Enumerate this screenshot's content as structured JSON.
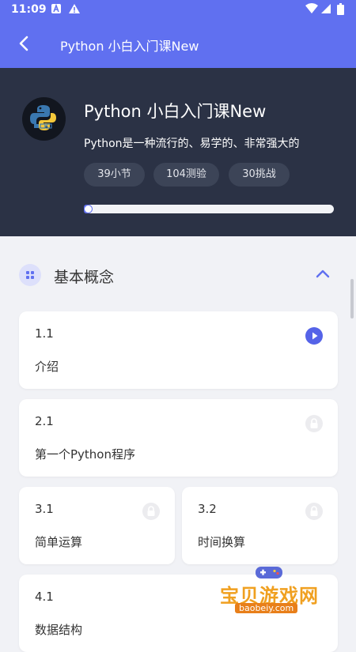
{
  "status_bar": {
    "time": "11:09"
  },
  "app_bar": {
    "title": "Python 小白入门课New"
  },
  "course": {
    "title": "Python 小白入门课New",
    "description": "Python是一种流行的、易学的、非常强大的",
    "chips": [
      "39小节",
      "104测验",
      "30挑战"
    ],
    "progress_fraction": 0.02
  },
  "section": {
    "title": "基本概念",
    "expanded": true
  },
  "lessons": [
    {
      "number": "1.1",
      "name": "介绍",
      "state": "play"
    },
    {
      "number": "2.1",
      "name": "第一个Python程序",
      "state": "locked"
    },
    {
      "number": "3.1",
      "name": "简单运算",
      "state": "locked"
    },
    {
      "number": "3.2",
      "name": "时间换算",
      "state": "locked"
    },
    {
      "number": "4.1",
      "name": "数据结构",
      "state": "locked"
    }
  ],
  "watermark": {
    "text": "宝贝游戏网",
    "url": "baobeiy.com"
  },
  "colors": {
    "accent": "#6070f0",
    "hero_bg": "#2b3245",
    "page_bg": "#f1f2f6",
    "play": "#5563e8"
  }
}
